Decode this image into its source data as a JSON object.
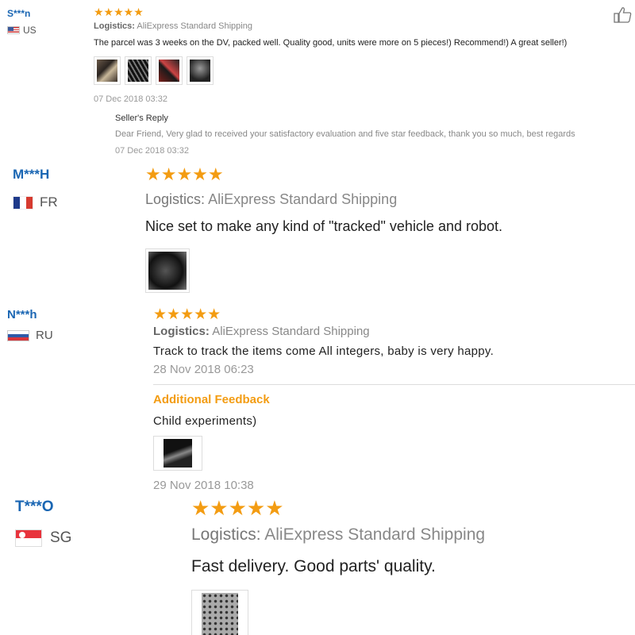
{
  "reviews": [
    {
      "name": "S***n",
      "country": "US",
      "stars": "★★★★★",
      "logistics_label": "Logistics:",
      "logistics_value": "AliExpress Standard Shipping",
      "text": "The parcel was 3 weeks on the DV, packed well. Quality good, units were more on 5 pieces!) Recommend!) A great seller!)",
      "date": "07 Dec 2018 03:32",
      "seller_reply_title": "Seller's Reply",
      "seller_reply_text": "Dear Friend, Very glad to received your satisfactory evaluation and five star feedback, thank you so much, best regards",
      "seller_reply_date": "07 Dec 2018 03:32",
      "photo_count": 4
    },
    {
      "name": "M***H",
      "country": "FR",
      "stars": "★★★★★",
      "logistics_label": "Logistics:",
      "logistics_value": "AliExpress Standard Shipping",
      "text": "Nice set to make any kind of \"tracked\" vehicle and robot."
    },
    {
      "name": "N***h",
      "country": "RU",
      "stars": "★★★★★",
      "logistics_label": "Logistics:",
      "logistics_value": "AliExpress Standard Shipping",
      "text": "Track to track the items come All integers, baby is very happy.",
      "date": "28 Nov 2018 06:23",
      "additional_title": "Additional Feedback",
      "additional_text": "Child experiments)",
      "additional_date": "29 Nov 2018 10:38"
    },
    {
      "name": "T***O",
      "country": "SG",
      "stars": "★★★★★",
      "logistics_label": "Logistics:",
      "logistics_value": "AliExpress Standard Shipping",
      "text": "Fast delivery. Good parts' quality."
    }
  ],
  "colors": {
    "name": "#1a66b3",
    "stars": "#f39c12",
    "additional": "#f39c12"
  },
  "icons": {
    "like": "thumbs-up-icon"
  }
}
